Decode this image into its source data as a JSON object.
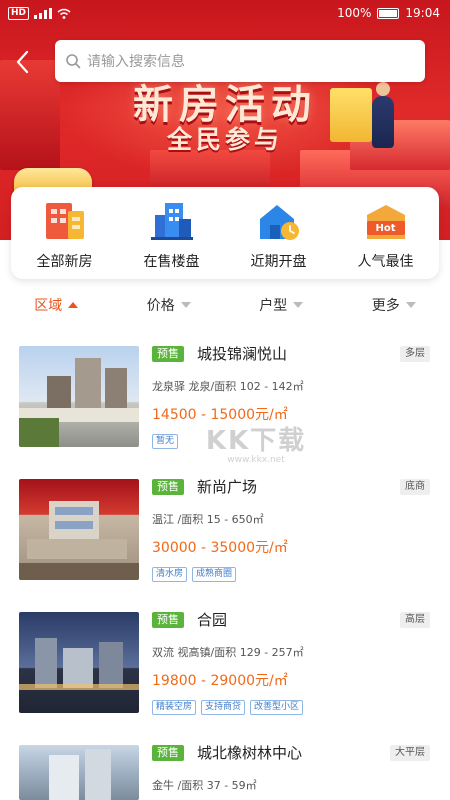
{
  "status_bar": {
    "left_badge": "HD",
    "right_text": "100%",
    "time": "19:04"
  },
  "search": {
    "placeholder": "请输入搜索信息",
    "icon": "search-icon"
  },
  "banner": {
    "title": "新房活动",
    "subtitle": "全民参与"
  },
  "categories": [
    {
      "label": "全部新房",
      "icon": "all-houses-icon"
    },
    {
      "label": "在售楼盘",
      "icon": "buildings-icon"
    },
    {
      "label": "近期开盘",
      "icon": "house-clock-icon"
    },
    {
      "label": "人气最佳",
      "icon": "hot-icon",
      "badge": "Hot"
    }
  ],
  "filters": [
    {
      "label": "区域",
      "active": true
    },
    {
      "label": "价格",
      "active": false
    },
    {
      "label": "户型",
      "active": false
    },
    {
      "label": "更多",
      "active": false
    }
  ],
  "listings": [
    {
      "status": "预售",
      "name": "城投锦澜悦山",
      "type": "多层",
      "location": "龙泉驿 龙泉/面积 102 - 142㎡",
      "price": "14500 - 15000元/㎡",
      "tags": [
        "暂无"
      ]
    },
    {
      "status": "预售",
      "name": "新尚广场",
      "type": "底商",
      "location": "温江 /面积 15 - 650㎡",
      "price": "30000 - 35000元/㎡",
      "tags": [
        "清水房",
        "成熟商圈"
      ]
    },
    {
      "status": "预售",
      "name": "合园",
      "type": "高层",
      "location": "双流 视高镇/面积 129 - 257㎡",
      "price": "19800 - 29000元/㎡",
      "tags": [
        "精装空房",
        "支持商贷",
        "改善型小区"
      ]
    },
    {
      "status": "预售",
      "name": "城北橡树林中心",
      "type": "大平层",
      "location": "金牛 /面积 37 - 59㎡",
      "price": "",
      "tags": []
    }
  ],
  "watermark": {
    "big": "KK下载",
    "small": "www.kkx.net"
  },
  "colors": {
    "accent": "#e8541e",
    "price": "#ef6a1a",
    "presale": "#5ab43c",
    "tag": "#3d7ccb"
  }
}
